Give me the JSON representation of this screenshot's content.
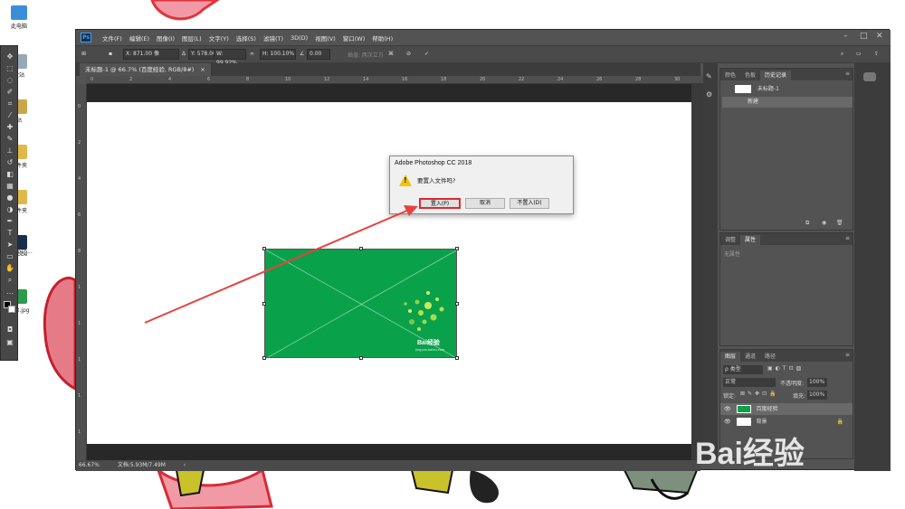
{
  "desktop": {
    "icons": [
      "此电脑",
      "收站",
      "站",
      "文件夹",
      "文件夹",
      "Adobe",
      "Photosh...",
      "经验.jpg"
    ]
  },
  "menubar": {
    "logo": "Ps",
    "items": [
      "文件(F)",
      "编辑(E)",
      "图像(I)",
      "图层(L)",
      "文字(Y)",
      "选择(S)",
      "滤镜(T)",
      "3D(D)",
      "视图(V)",
      "窗口(W)",
      "帮助(H)"
    ]
  },
  "options": {
    "x": "X: 871.00 像",
    "y": "Y: 578.00 像",
    "w": "W: 99.92%",
    "h": "H: 100.10%",
    "angle": "0.00",
    "interp": "插值: 两次立方",
    "warp_icon": "warp-icon"
  },
  "document": {
    "tab_label": "未标题-1 @ 66.7% (百度经验, RGB/8#)",
    "close": "×"
  },
  "rulers": {
    "top": [
      "0",
      "2",
      "4",
      "6",
      "8",
      "10",
      "12",
      "14",
      "16",
      "18",
      "20",
      "22",
      "24",
      "26",
      "28",
      "30"
    ],
    "left": [
      "0",
      "2",
      "4",
      "6",
      "8",
      "1",
      "1",
      "1",
      "1",
      "1"
    ]
  },
  "status": {
    "zoom": "66.67%",
    "doc": "文档:5.93M/7.49M"
  },
  "dialog": {
    "title": "Adobe Photoshop CC 2018",
    "message": "要置入文件吗?",
    "buttons": [
      "置入(P)",
      "取消",
      "不置入(D)"
    ]
  },
  "placed_image": {
    "brand": "Bai经验",
    "sub": "jingyan.baidu.com"
  },
  "panels": {
    "history": {
      "tabs": [
        "颜色",
        "色板",
        "历史记录"
      ],
      "snapshot": "未标题-1",
      "states": [
        "新建"
      ]
    },
    "properties": {
      "tabs": [
        "调整",
        "属性"
      ],
      "empty": "无属性"
    },
    "layers": {
      "tabs": [
        "图层",
        "通道",
        "路径"
      ],
      "kind": "ρ 类型",
      "blend": "正常",
      "opacity_label": "不透明度:",
      "opacity": "100%",
      "lock_label": "锁定:",
      "fill_label": "填充:",
      "fill": "100%",
      "items": [
        "百度经验",
        "背景"
      ]
    }
  },
  "watermark": {
    "brand": "Bai经验",
    "url": "jingyan.baidu.com"
  },
  "colors": {
    "ps_bg": "#535353",
    "accent": "#31a8ff",
    "green": "#0aa14b",
    "arrow": "#e8413e"
  }
}
